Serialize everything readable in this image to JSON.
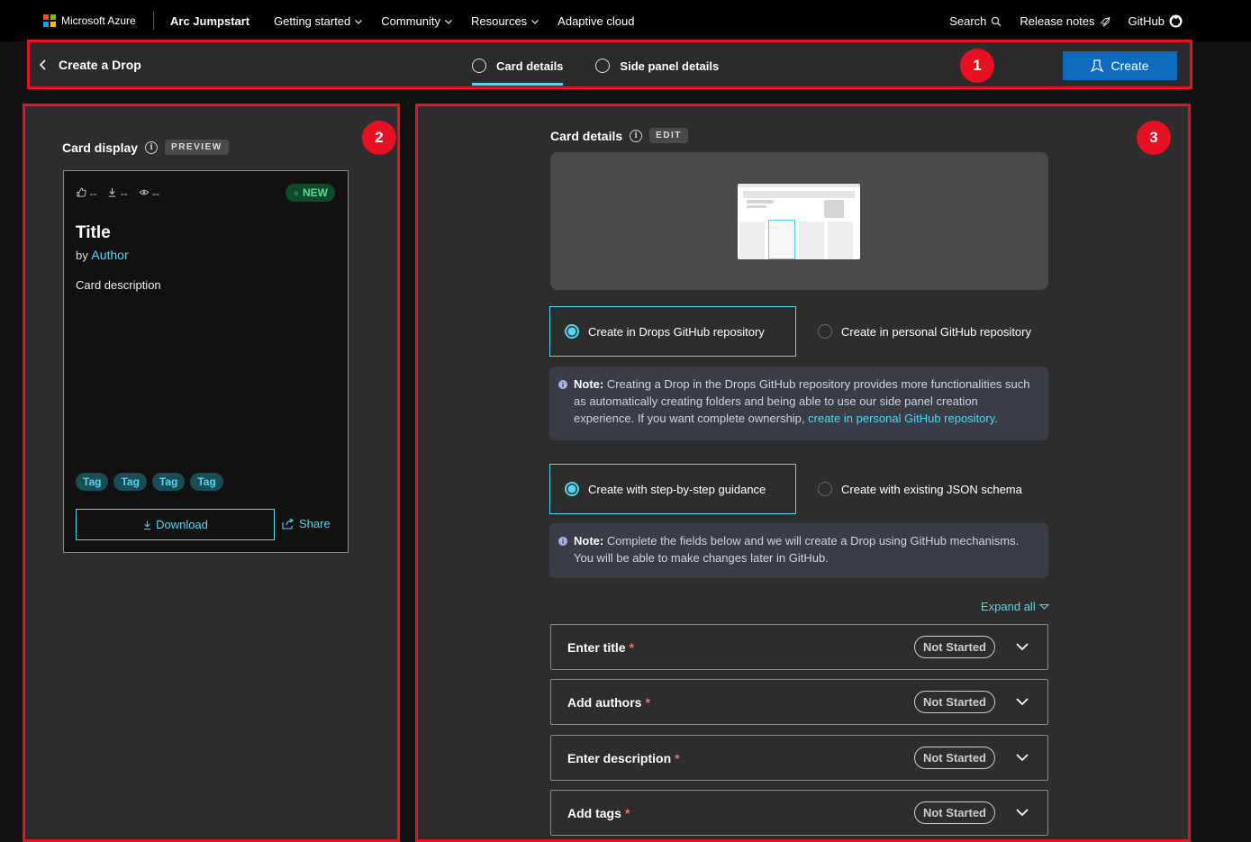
{
  "topnav": {
    "ms_logo_text": "Microsoft Azure",
    "brand": "Arc Jumpstart",
    "links": [
      {
        "label": "Getting started",
        "dropdown": true
      },
      {
        "label": "Community",
        "dropdown": true
      },
      {
        "label": "Resources",
        "dropdown": true
      },
      {
        "label": "Adaptive cloud",
        "dropdown": false
      }
    ],
    "search": "Search",
    "release_notes": "Release notes",
    "github": "GitHub"
  },
  "toolbar": {
    "back_label": "Create a Drop",
    "tabs": [
      {
        "label": "Card details",
        "active": true
      },
      {
        "label": "Side panel details",
        "active": false
      }
    ],
    "create_label": "Create"
  },
  "markers": [
    "1",
    "2",
    "3"
  ],
  "card_display": {
    "heading": "Card display",
    "chip": "PREVIEW",
    "stats": {
      "likes": "--",
      "downloads": "--",
      "views": "--"
    },
    "badge": "NEW",
    "title": "Title",
    "by": "by",
    "author": "Author",
    "description": "Card description",
    "tags": [
      "Tag",
      "Tag",
      "Tag",
      "Tag"
    ],
    "download_label": "Download",
    "share_label": "Share"
  },
  "card_details": {
    "heading": "Card details",
    "chip": "EDIT",
    "repo_choice": {
      "selected": "Create in Drops GitHub repository",
      "other": "Create in personal GitHub repository"
    },
    "note1": {
      "prefix": "Note:",
      "text": " Creating a Drop in the Drops GitHub repository provides more functionalities such as automatically creating folders and being able to use our side panel creation experience. If you want complete ownership, ",
      "link": "create in personal GitHub repository",
      "suffix": "."
    },
    "mode_choice": {
      "selected": "Create with step-by-step guidance",
      "other": "Create with existing JSON schema"
    },
    "note2": {
      "prefix": "Note:",
      "text": " Complete the fields below and we will create a Drop using GitHub mechanisms. You will be able to make changes later in GitHub."
    },
    "expand_all": "Expand all",
    "sections": [
      {
        "label": "Enter title",
        "status": "Not Started"
      },
      {
        "label": "Add authors",
        "status": "Not Started"
      },
      {
        "label": "Enter description",
        "status": "Not Started"
      },
      {
        "label": "Add tags",
        "status": "Not Started"
      }
    ],
    "required_mark": "*"
  },
  "colors": {
    "accent": "#50d8f0",
    "primary_button": "#0f6cbd",
    "highlight_border": "#e81123",
    "badge_new": "#4fe08f"
  }
}
